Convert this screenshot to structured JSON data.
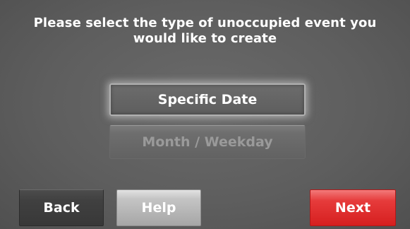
{
  "prompt": {
    "line1": "Please select the type of unoccupied event you",
    "line2": "would like to create"
  },
  "options": [
    {
      "label": "Specific Date",
      "state": "selected"
    },
    {
      "label": "Month / Weekday",
      "state": "disabled"
    }
  ],
  "footer": {
    "back_label": "Back",
    "help_label": "Help",
    "next_label": "Next"
  },
  "colors": {
    "background": "#5e5e5e",
    "next_button": "#e63b3b",
    "help_button": "#c4c4c4",
    "back_button": "#404040"
  }
}
